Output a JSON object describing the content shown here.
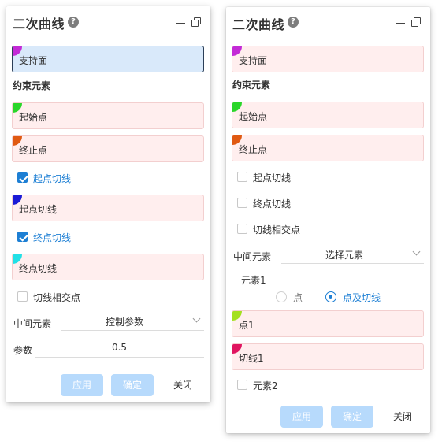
{
  "colors": {
    "accent": "#1d7fd4",
    "field_bg": "#ffeeee",
    "active_bg": "#d9e9fa",
    "button_disabled": "#b7dafc"
  },
  "left": {
    "title": "二次曲线",
    "help_icon": "?",
    "support": "支持面",
    "constraint_section": "约束元素",
    "start_point": "起始点",
    "end_point": "终止点",
    "start_tangent_check": "起点切线",
    "start_tangent_field": "起点切线",
    "end_tangent_check": "终点切线",
    "end_tangent_field": "终点切线",
    "tangent_intersection": "切线相交点",
    "middle_label": "中间元素",
    "middle_value": "控制参数",
    "param_label": "参数",
    "param_value": "0.5",
    "apply": "应用",
    "ok": "确定",
    "close": "关闭"
  },
  "right": {
    "title": "二次曲线",
    "help_icon": "?",
    "support": "支持面",
    "constraint_section": "约束元素",
    "start_point": "起始点",
    "end_point": "终止点",
    "start_tangent_check": "起点切线",
    "end_tangent_check": "终点切线",
    "tangent_intersection": "切线相交点",
    "middle_label": "中间元素",
    "middle_value": "选择元素",
    "element1_label": "元素1",
    "radio_point": "点",
    "radio_point_tangent": "点及切线",
    "point1": "点1",
    "tangent1": "切线1",
    "element2": "元素2",
    "apply": "应用",
    "ok": "确定",
    "close": "关闭"
  }
}
